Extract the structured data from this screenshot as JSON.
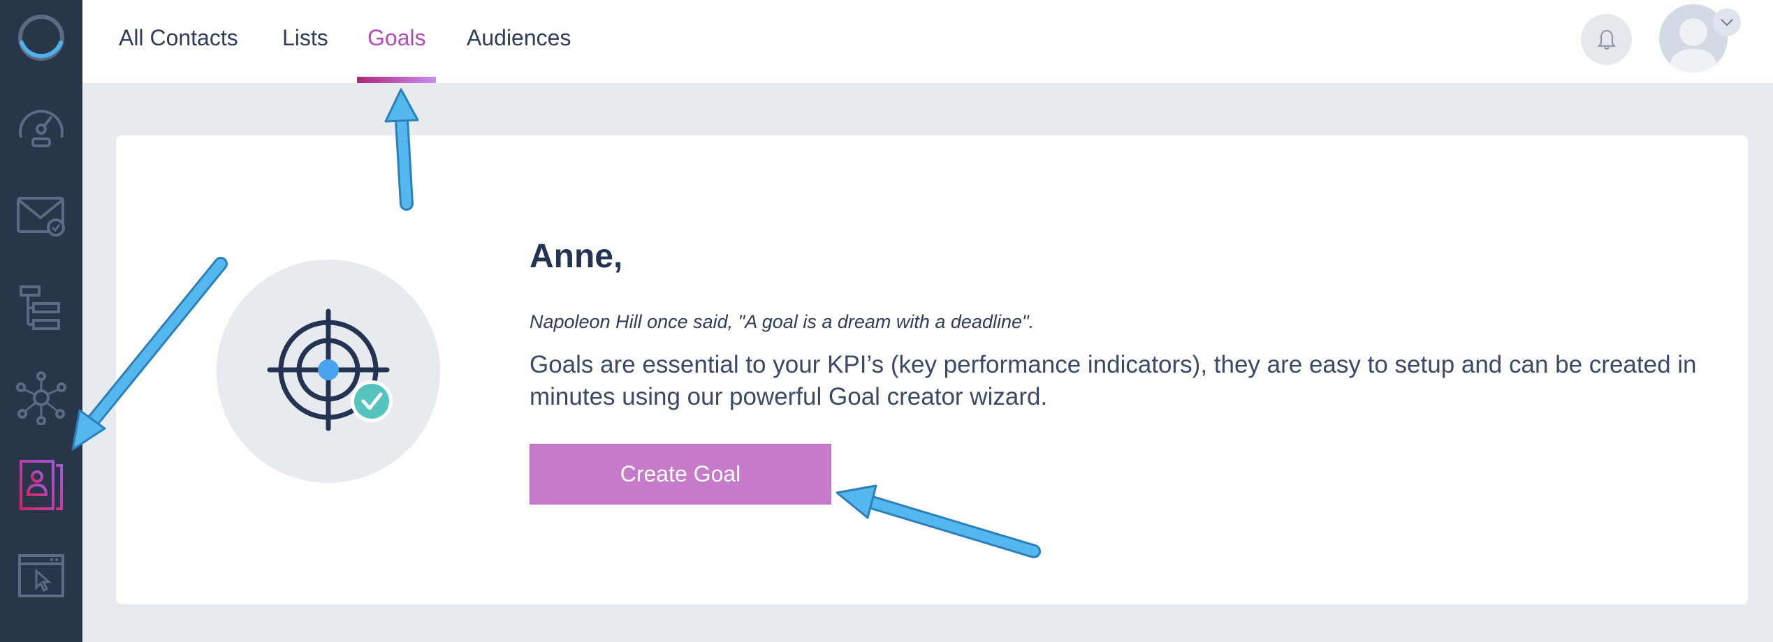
{
  "nav": {
    "tabs": [
      {
        "label": "All Contacts"
      },
      {
        "label": "Lists"
      },
      {
        "label": "Goals",
        "active": true
      },
      {
        "label": "Audiences"
      }
    ]
  },
  "sidebar": {
    "items": [
      {
        "icon": "logo-ring-icon"
      },
      {
        "icon": "dashboard-gauge-icon"
      },
      {
        "icon": "email-icon"
      },
      {
        "icon": "workflow-icon"
      },
      {
        "icon": "network-icon"
      },
      {
        "icon": "contacts-icon",
        "active": true
      },
      {
        "icon": "browser-cursor-icon"
      }
    ]
  },
  "header": {
    "bell_icon": "bell-icon",
    "avatar_icon": "user-avatar"
  },
  "main": {
    "greeting": "Anne,",
    "quote": "Napoleon Hill once said, \"A goal is a dream with a deadline\".",
    "description": "Goals are essential to your KPI’s (key performance indicators), they are easy to setup and can be created in minutes using our powerful Goal creator wizard.",
    "cta_label": "Create Goal",
    "illustration_icon": "target-check-icon"
  },
  "colors": {
    "sidebar_bg": "#293548",
    "accent": "#b04fb8",
    "button": "#c57bc9",
    "annotation_arrow": "#4fb3ea"
  }
}
